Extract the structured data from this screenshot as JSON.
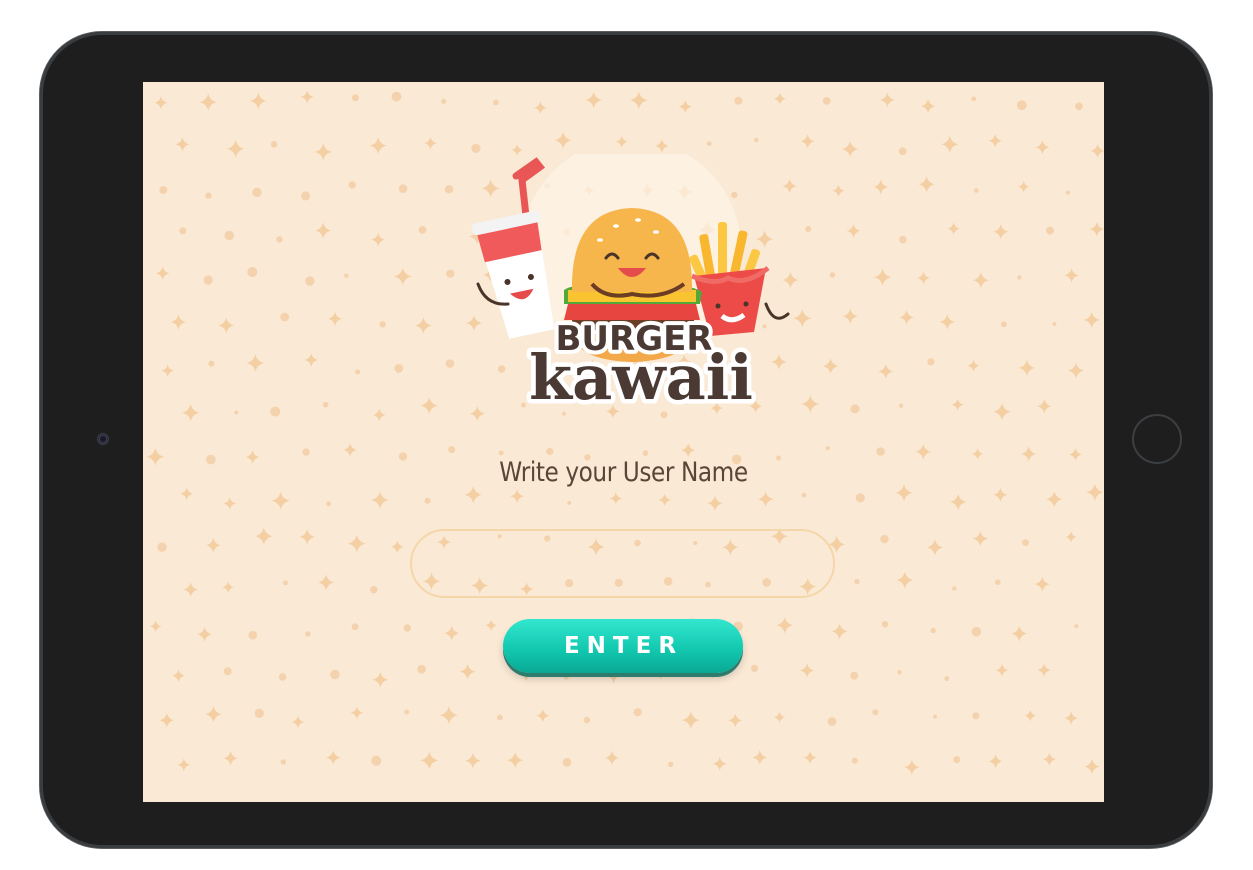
{
  "logo": {
    "line1": "BURGER",
    "line2": "kawaii"
  },
  "form": {
    "prompt": "Write your User Name",
    "username_value": "",
    "username_placeholder": "",
    "enter_label": "ENTER"
  },
  "colors": {
    "screen_background": "#fae9d5",
    "pattern": "#f2c99a",
    "input_border": "#f5d6a9",
    "button": "#13c9b0",
    "text": "#5a4637"
  }
}
